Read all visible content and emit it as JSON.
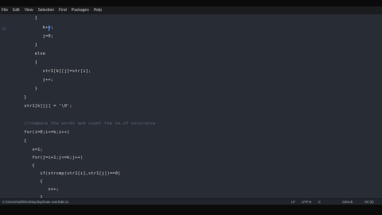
{
  "menu": [
    "File",
    "Edit",
    "View",
    "Selection",
    "Find",
    "Packages",
    "Help"
  ],
  "gutter": {
    "marker": "25"
  },
  "code": [
    "       }",
    "          k++;",
    "          j=0;",
    "       }",
    "       else",
    "       {",
    "          str1[k][j]=str[i];",
    "          j++;",
    "       }",
    "   }",
    "   str1[k][j] = '\\0';",
    "",
    "   //compare the words and count the no.of occurence",
    "   for(i=0;i<=k;i++)",
    "   {",
    "      x=1;",
    "      for(j=i+1;j<=k;j++)",
    "      {",
    "         if(strcmp(str1[i],str1[j])==0)",
    "         {",
    "            x++;",
    "         }",
    "      }",
    "      if(x>=max)",
    "      {",
    "         max=x;"
  ],
  "status": {
    "path": "C:/Users/sahil/Desktop/duplicate words.c",
    "position": "25:11",
    "line_ending": "LF",
    "encoding": "UTF-8",
    "grammar": "C",
    "github": "GitHub",
    "git": "Git (0)"
  }
}
